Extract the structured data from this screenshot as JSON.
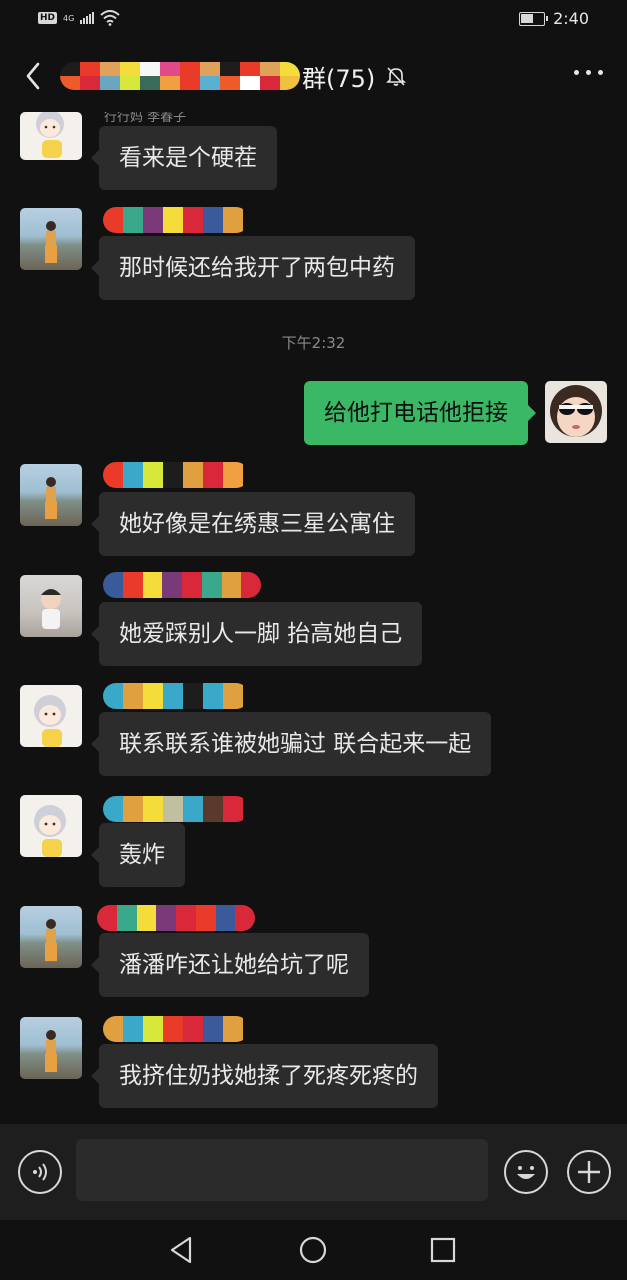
{
  "status_bar": {
    "network_badge": "HD",
    "network_type": "4G",
    "time": "2:40",
    "battery_level": 0.55
  },
  "header": {
    "title_suffix": "群(75)",
    "muted": true,
    "back_icon": "chevron-left-icon",
    "more_icon": "more-dots-icon"
  },
  "colors": {
    "background": "#111111",
    "bubble_incoming": "#2c2c2c",
    "bubble_outgoing": "#3bb865",
    "text": "#e8e8e8",
    "meta_text": "#8a8a8a"
  },
  "messages": [
    {
      "type": "incoming",
      "avatar": "cartoon-girl-avatar",
      "nickname_visible": "行行妈 李春子",
      "text": "看来是个硬茬"
    },
    {
      "type": "incoming",
      "avatar": "beach-girl-avatar",
      "text": "那时候还给我开了两包中药"
    },
    {
      "type": "timestamp",
      "text": "下午2:32"
    },
    {
      "type": "outgoing",
      "avatar": "sunglasses-girl-avatar",
      "text": "给他打电话他拒接"
    },
    {
      "type": "incoming",
      "avatar": "beach-girl-avatar",
      "text": "她好像是在绣惠三星公寓住"
    },
    {
      "type": "incoming",
      "avatar": "baby-photo-avatar",
      "text": "她爱踩别人一脚 抬高她自己"
    },
    {
      "type": "incoming",
      "avatar": "cartoon-girl-avatar",
      "text": "联系联系谁被她骗过 联合起来一起"
    },
    {
      "type": "incoming",
      "avatar": "cartoon-girl-avatar",
      "text": "轰炸"
    },
    {
      "type": "incoming",
      "avatar": "beach-girl-avatar",
      "text": "潘潘咋还让她给坑了呢"
    },
    {
      "type": "incoming",
      "avatar": "beach-girl-avatar",
      "text": "我挤住奶找她揉了死疼死疼的"
    }
  ],
  "input_bar": {
    "voice_icon": "voice-input-icon",
    "emoji_icon": "emoji-icon",
    "plus_icon": "add-icon",
    "input_value": ""
  },
  "nav_bar": {
    "back_icon": "nav-back-icon",
    "home_icon": "nav-home-icon",
    "recents_icon": "nav-recents-icon"
  }
}
